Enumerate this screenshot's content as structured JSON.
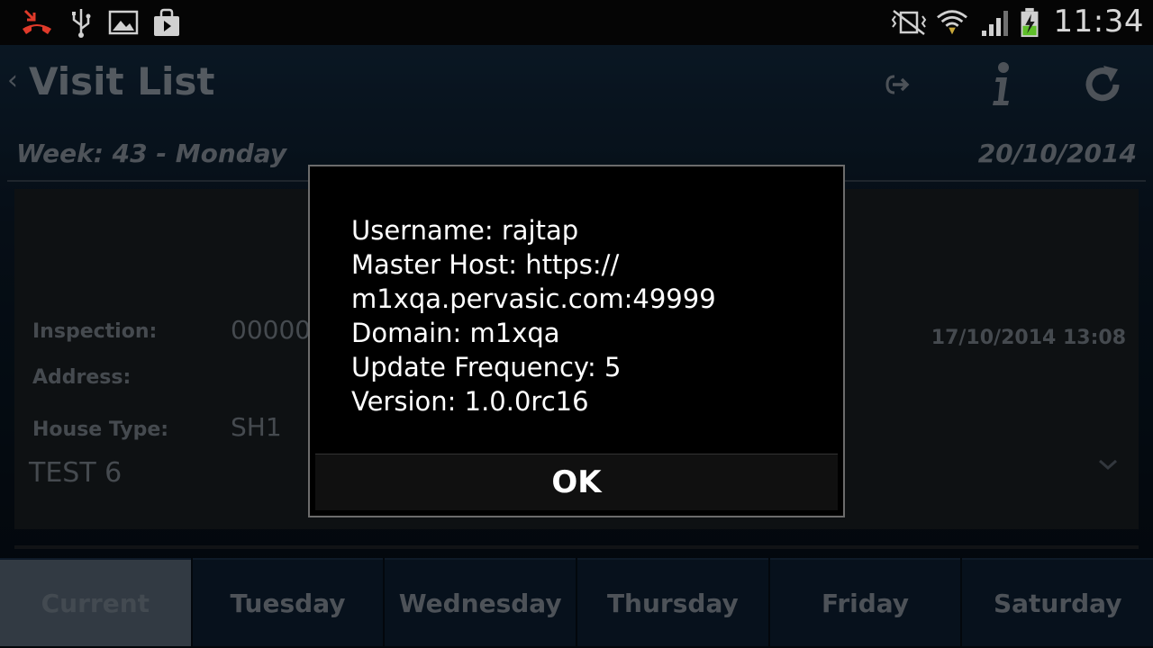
{
  "status_bar": {
    "time": "11:34",
    "icons": [
      "missed-call-icon",
      "usb-icon",
      "image-icon",
      "shopping-bag-icon",
      "vibrate-mute-icon",
      "wifi-icon",
      "signal-icon",
      "battery-charging-icon"
    ]
  },
  "action_bar": {
    "title": "Visit List",
    "buttons": [
      "logout-icon",
      "info-icon",
      "refresh-icon"
    ]
  },
  "week_row": {
    "week": "Week: 43 - Monday",
    "date": "20/10/2014"
  },
  "card": {
    "inspection_label": "Inspection:",
    "inspection_value": "00000",
    "address_label": "Address:",
    "house_type_label": "House Type:",
    "house_type_value": "SH1",
    "name": "TEST 6",
    "timestamp": "17/10/2014 13:08"
  },
  "tabs": [
    {
      "label": "Current",
      "active": true
    },
    {
      "label": "Tuesday",
      "active": false
    },
    {
      "label": "Wednesday",
      "active": false
    },
    {
      "label": "Thursday",
      "active": false
    },
    {
      "label": "Friday",
      "active": false
    },
    {
      "label": "Saturday",
      "active": false
    }
  ],
  "dialog": {
    "lines": [
      "Username: rajtap",
      "Master Host: https://",
      "m1xqa.pervasic.com:49999",
      "Domain: m1xqa",
      "Update Frequency: 5",
      "Version: 1.0.0rc16"
    ],
    "ok_label": "OK"
  }
}
